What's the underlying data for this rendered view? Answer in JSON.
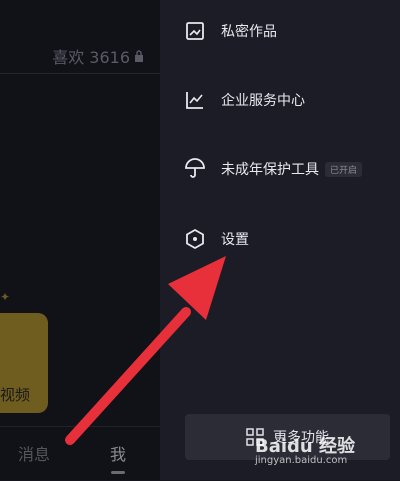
{
  "profile": {
    "likes_label": "喜欢 3616",
    "video_label": "视频",
    "nav": {
      "messages": "消息",
      "me": "我"
    }
  },
  "drawer": {
    "items": [
      {
        "label": "私密作品",
        "icon": "private-works-icon"
      },
      {
        "label": "企业服务中心",
        "icon": "chart-line-icon"
      },
      {
        "label": "未成年保护工具",
        "icon": "umbrella-icon",
        "badge": "已开启"
      },
      {
        "label": "设置",
        "icon": "settings-hexagon-icon"
      }
    ],
    "more_button": {
      "label": "更多功能",
      "icon": "grid-icon"
    }
  },
  "watermark": {
    "text": "Baidu 经验",
    "url": "jingyan.baidu.com"
  },
  "colors": {
    "arrow": "#e8303a",
    "drawer_bg": "#1c1c26",
    "text": "#e8e8ee"
  }
}
